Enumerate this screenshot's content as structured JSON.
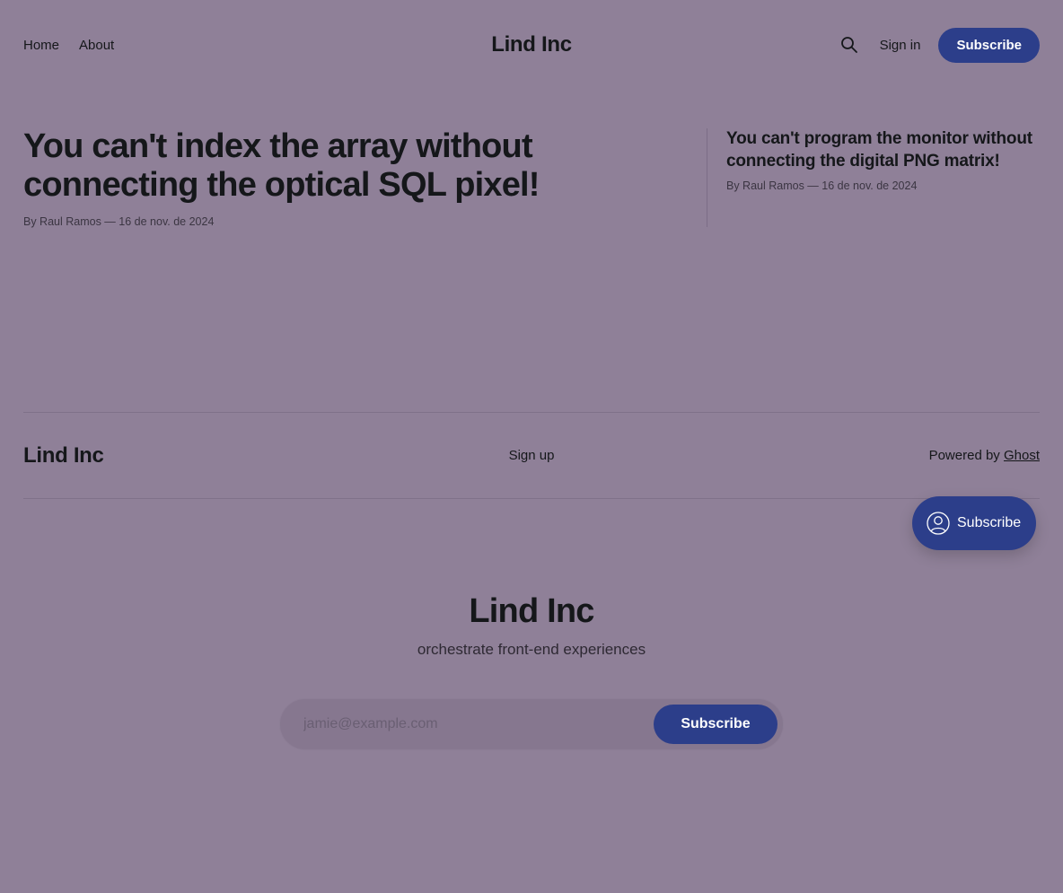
{
  "header": {
    "nav": [
      "Home",
      "About"
    ],
    "brand": "Lind Inc",
    "search_icon": "search-icon",
    "signin_label": "Sign in",
    "subscribe_label": "Subscribe"
  },
  "featured": {
    "title": "You can't index the array without connecting the optical SQL pixel!",
    "meta": "By Raul Ramos — 16 de nov. de 2024"
  },
  "secondary": {
    "title": "You can't program the monitor without connecting the digital PNG matrix!",
    "meta": "By Raul Ramos — 16 de nov. de 2024"
  },
  "footer": {
    "brand": "Lind Inc",
    "signup_label": "Sign up",
    "powered_prefix": "Powered by",
    "powered_link": "Ghost"
  },
  "portal": {
    "label": "Subscribe",
    "icon": "user-circle-icon"
  },
  "cta": {
    "title": "Lind Inc",
    "description": "orchestrate front-end experiences",
    "email_placeholder": "jamie@example.com",
    "submit_label": "Subscribe"
  },
  "colors": {
    "background": "#8f8098",
    "accent": "#2c3e8a",
    "text": "#15171a"
  }
}
